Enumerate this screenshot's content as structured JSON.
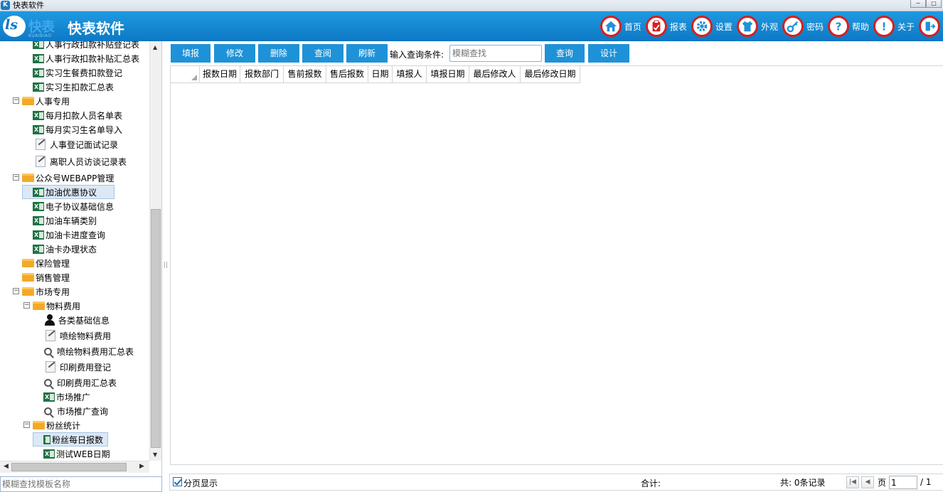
{
  "window": {
    "title": "快表软件",
    "min": "−",
    "max": "□"
  },
  "header": {
    "logo_text": "快表",
    "logo_sub": "KUAIBIAO",
    "app_name": "快表软件",
    "nav": [
      {
        "label": "首页"
      },
      {
        "label": "报表"
      },
      {
        "label": "设置"
      },
      {
        "label": "外观"
      },
      {
        "label": "密码"
      },
      {
        "label": "帮助"
      },
      {
        "label": "关于"
      }
    ],
    "accent": "#0e78c4",
    "icon_ring": "#d42020"
  },
  "tree": {
    "nodes": [
      {
        "label": "人事行政扣款补贴登记表",
        "icon": "xls"
      },
      {
        "label": "人事行政扣款补贴汇总表",
        "icon": "xls"
      },
      {
        "label": "实习生餐费扣款登记",
        "icon": "xls"
      },
      {
        "label": "实习生扣款汇总表",
        "icon": "xls"
      },
      {
        "label": "人事专用",
        "icon": "folder",
        "expander": "−"
      },
      {
        "label": "每月扣款人员名单表",
        "icon": "xls"
      },
      {
        "label": "每月实习生名单导入",
        "icon": "xls"
      },
      {
        "label": "人事登记面试记录",
        "icon": "form"
      },
      {
        "label": "离职人员访谈记录表",
        "icon": "form"
      },
      {
        "label": "公众号WEBAPP管理",
        "icon": "folder",
        "expander": "−"
      },
      {
        "label": "加油优惠协议",
        "icon": "xls",
        "selected": true
      },
      {
        "label": "电子协议基础信息",
        "icon": "xls"
      },
      {
        "label": "加油车辆类别",
        "icon": "xls"
      },
      {
        "label": "加油卡进度查询",
        "icon": "xls"
      },
      {
        "label": "油卡办理状态",
        "icon": "xls"
      },
      {
        "label": "保险管理",
        "icon": "folder"
      },
      {
        "label": "销售管理",
        "icon": "folder"
      },
      {
        "label": "市场专用",
        "icon": "folder",
        "expander": "−"
      },
      {
        "label": "物料费用",
        "icon": "folder",
        "expander": "−"
      },
      {
        "label": "各类基础信息",
        "icon": "person"
      },
      {
        "label": "喷绘物料费用",
        "icon": "form"
      },
      {
        "label": "喷绘物料费用汇总表",
        "icon": "search"
      },
      {
        "label": "印刷费用登记",
        "icon": "form"
      },
      {
        "label": "印刷费用汇总表",
        "icon": "search"
      },
      {
        "label": "市场推广",
        "icon": "xls"
      },
      {
        "label": "市场推广查询",
        "icon": "search"
      },
      {
        "label": "粉丝统计",
        "icon": "folder",
        "expander": "−"
      },
      {
        "label": "粉丝每日报数",
        "icon": "xls",
        "selected": true
      },
      {
        "label": "测试WEB日期",
        "icon": "xls"
      }
    ]
  },
  "template_search": {
    "placeholder": "模糊查找模板名称"
  },
  "toolbar": {
    "buttons": [
      {
        "label": "填报"
      },
      {
        "label": "修改"
      },
      {
        "label": "删除"
      },
      {
        "label": "查阅"
      },
      {
        "label": "刷新"
      }
    ],
    "condition_label": "输入查询条件:",
    "condition_placeholder": "模糊查找",
    "query_label": "查询",
    "design_label": "设计"
  },
  "grid": {
    "columns": [
      "报数日期",
      "报数部门",
      "售前报数",
      "售后报数",
      "日期",
      "填报人",
      "填报日期",
      "最后修改人",
      "最后修改日期"
    ]
  },
  "footer": {
    "paging_label": "分页显示",
    "sum_label": "合计:",
    "total_label": "共: 0条记录",
    "page_word": "页",
    "page_value": "1",
    "page_total": "/ 1"
  }
}
